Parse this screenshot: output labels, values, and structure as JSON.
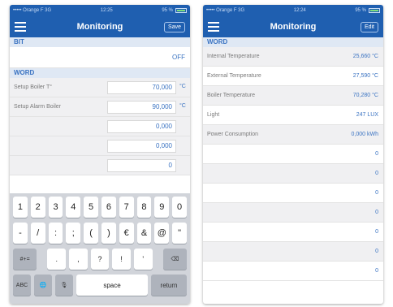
{
  "left": {
    "status": {
      "carrier": "••••• Orange F  3G",
      "time": "12:25",
      "battery": "95 %"
    },
    "nav": {
      "title": "Monitoring",
      "action": "Save"
    },
    "bit_header": "BIT",
    "bit_value": "OFF",
    "word_header": "WORD",
    "rows": [
      {
        "label": "Setup Boiler T°",
        "value": "70,000",
        "unit": "°C"
      },
      {
        "label": "Setup Alarm Boiler",
        "value": "90,000",
        "unit": "°C"
      },
      {
        "label": "",
        "value": "0,000",
        "unit": ""
      },
      {
        "label": "",
        "value": "0,000",
        "unit": ""
      },
      {
        "label": "",
        "value": "0",
        "unit": ""
      }
    ],
    "keyboard": {
      "row1": [
        "1",
        "2",
        "3",
        "4",
        "5",
        "6",
        "7",
        "8",
        "9",
        "0"
      ],
      "row2": [
        "-",
        "/",
        ":",
        ";",
        "(",
        ")",
        "€",
        "&",
        "@",
        "\""
      ],
      "row3_left": "#+=",
      "row3_keys": [
        ".",
        ",",
        "?",
        "!",
        "'"
      ],
      "row3_right": "⌫",
      "abc": "ABC",
      "globe": "🌐",
      "mic": "🎙",
      "space": "space",
      "return": "return"
    }
  },
  "right": {
    "status": {
      "carrier": "••••• Orange F  3G",
      "time": "12:24",
      "battery": "95 %"
    },
    "nav": {
      "title": "Monitoring",
      "action": "Edit"
    },
    "word_header": "WORD",
    "rows": [
      {
        "label": "Internal Temperature",
        "value": "25,660 °C"
      },
      {
        "label": "External Temperature",
        "value": "27,590 °C"
      },
      {
        "label": "Boiler Temperature",
        "value": "70,280 °C"
      },
      {
        "label": "Light",
        "value": "247 LUX"
      },
      {
        "label": "Power Consumption",
        "value": "0,000 kWh"
      }
    ],
    "empty_rows": [
      "0",
      "0",
      "0",
      "0",
      "0",
      "0",
      "0"
    ]
  }
}
